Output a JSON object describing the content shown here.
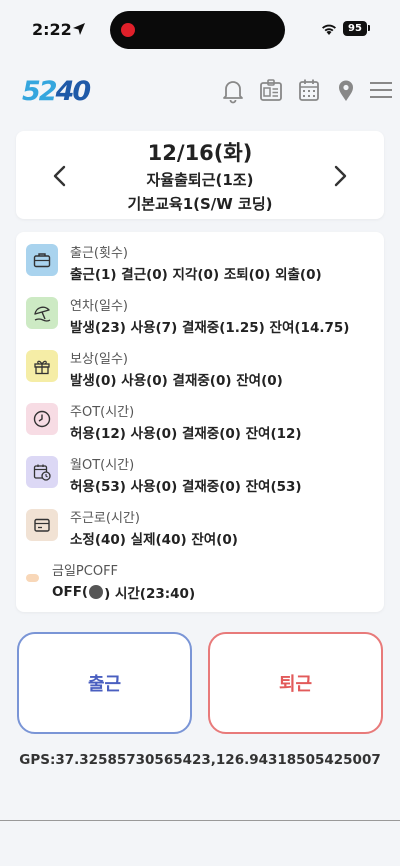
{
  "status_bar": {
    "time": "2:22",
    "battery": "95"
  },
  "header": {
    "logo_part1": "52",
    "logo_part2": "40",
    "icons": [
      "bell-icon",
      "id-card-icon",
      "calendar-icon",
      "location-pin-icon",
      "menu-icon"
    ]
  },
  "date_card": {
    "date": "12/16(화)",
    "schedule": "자율출퇴근(1조)",
    "training": "기본교육1(S/W 코딩)"
  },
  "stats": [
    {
      "label": "출근(횟수)",
      "value": "출근(1) 결근(0) 지각(0) 조퇴(0) 외출(0)",
      "icon": "briefcase-icon",
      "color": "#a9d3ee"
    },
    {
      "label": "연차(일수)",
      "value": "발생(23) 사용(7) 결재중(1.25) 잔여(14.75)",
      "icon": "beach-umbrella-icon",
      "color": "#cdeac4"
    },
    {
      "label": "보상(일수)",
      "value": "발생(0) 사용(0) 결재중(0) 잔여(0)",
      "icon": "gift-icon",
      "color": "#f5eda6"
    },
    {
      "label": "주OT(시간)",
      "value": "허용(12) 사용(0) 결재중(0) 잔여(12)",
      "icon": "clock-icon",
      "color": "#f7dce4"
    },
    {
      "label": "월OT(시간)",
      "value": "허용(53) 사용(0) 결재중(0) 잔여(53)",
      "icon": "calendar-clock-icon",
      "color": "#dcd8f5"
    },
    {
      "label": "주근로(시간)",
      "value": "소정(40) 실제(40) 잔여(0)",
      "icon": "wallet-icon",
      "color": "#f1e2d4"
    }
  ],
  "pcoff": {
    "label": "금일PCOFF",
    "status_prefix": "OFF(",
    "status_suffix": ") 시간(23:40)"
  },
  "buttons": {
    "clock_in": "출근",
    "clock_out": "퇴근"
  },
  "gps": "GPS:37.32585730565423,126.94318505425007"
}
